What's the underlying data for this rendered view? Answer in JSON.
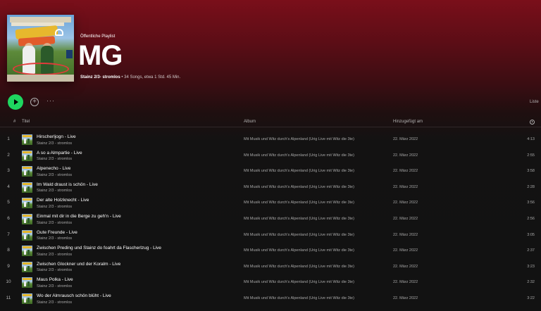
{
  "playlist": {
    "type_label": "Öffentliche Playlist",
    "title": "MG",
    "owner": "Stainz 2/3- stromlos",
    "stats": " • 34 Songs, etwa 1 Std. 45 Min."
  },
  "controls": {
    "add_symbol": "+",
    "more_symbol": "···",
    "view_label": "Liste"
  },
  "columns": {
    "number": "#",
    "title": "Titel",
    "album": "Album",
    "date_added": "Hinzugefügt am"
  },
  "tracks": [
    {
      "num": "1",
      "title": "Hirscherljogn - Live",
      "artist": "Stainz 2/3 - stromlos",
      "album": "Mit Musik und Witz durch's Alpenland (Urig Live mit Witz die 3te)",
      "date": "22. März 2022",
      "duration": "4:13"
    },
    {
      "num": "2",
      "title": "A so a Almpartie - Live",
      "artist": "Stainz 2/3 - stromlos",
      "album": "Mit Musik und Witz durch's Alpenland (Urig Live mit Witz die 3te)",
      "date": "22. März 2022",
      "duration": "2:55"
    },
    {
      "num": "3",
      "title": "Alpenecho - Live",
      "artist": "Stainz 2/3 - stromlos",
      "album": "Mit Musik und Witz durch's Alpenland (Urig Live mit Witz die 3te)",
      "date": "22. März 2022",
      "duration": "3:58"
    },
    {
      "num": "4",
      "title": "Im Wald draust is schön - Live",
      "artist": "Stainz 2/3 - stromlos",
      "album": "Mit Musik und Witz durch's Alpenland (Urig Live mit Witz die 3te)",
      "date": "22. März 2022",
      "duration": "2:28"
    },
    {
      "num": "5",
      "title": "Der alte Holzknecht - Live",
      "artist": "Stainz 2/3 - stromlos",
      "album": "Mit Musik und Witz durch's Alpenland (Urig Live mit Witz die 3te)",
      "date": "22. März 2022",
      "duration": "3:56"
    },
    {
      "num": "6",
      "title": "Einmal mit dir in die Berge zu geh'n - Live",
      "artist": "Stainz 2/3 - stromlos",
      "album": "Mit Musik und Witz durch's Alpenland (Urig Live mit Witz die 3te)",
      "date": "22. März 2022",
      "duration": "2:56"
    },
    {
      "num": "7",
      "title": "Gute Freunde - Live",
      "artist": "Stainz 2/3 - stromlos",
      "album": "Mit Musik und Witz durch's Alpenland (Urig Live mit Witz die 3te)",
      "date": "22. März 2022",
      "duration": "3:05"
    },
    {
      "num": "8",
      "title": "Zwischen Preding und Stainz do foahrt da Flascherlzug - Live",
      "artist": "Stainz 2/3 - stromlos",
      "album": "Mit Musik und Witz durch's Alpenland (Urig Live mit Witz die 3te)",
      "date": "22. März 2022",
      "duration": "2:37"
    },
    {
      "num": "9",
      "title": "Zwischen Glockner und der Koralm - Live",
      "artist": "Stainz 2/3 - stromlos",
      "album": "Mit Musik und Witz durch's Alpenland (Urig Live mit Witz die 3te)",
      "date": "22. März 2022",
      "duration": "3:23"
    },
    {
      "num": "10",
      "title": "Maus Polka - Live",
      "artist": "Stainz 2/3 - stromlos",
      "album": "Mit Musik und Witz durch's Alpenland (Urig Live mit Witz die 3te)",
      "date": "22. März 2022",
      "duration": "2:32"
    },
    {
      "num": "11",
      "title": "Wo der Almrausch schön blüht - Live",
      "artist": "Stainz 2/3 - stromlos",
      "album": "Mit Musik und Witz durch's Alpenland (Urig Live mit Witz die 3te)",
      "date": "22. März 2022",
      "duration": "3:22"
    }
  ],
  "colors": {
    "accent": "#1ed760",
    "header_gradient_top": "#7a0f1a",
    "background": "#121212"
  }
}
